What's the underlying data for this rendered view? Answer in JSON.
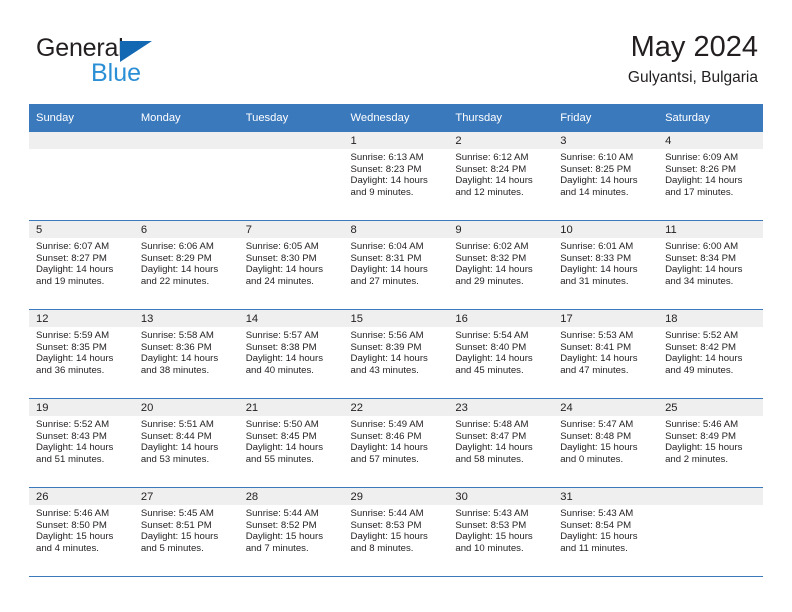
{
  "brand": {
    "name_part1": "General",
    "name_part2": "Blue",
    "triangle_color": "#1268b3",
    "blue_text_color": "#2b8fd6"
  },
  "header": {
    "title": "May 2024",
    "subtitle": "Gulyantsi, Bulgaria"
  },
  "theme": {
    "header_row_bg": "#3b79bd",
    "daynum_band_bg": "#efefef",
    "row_divider": "#3b79bd",
    "text": "#231f20"
  },
  "weekday_headers": [
    "Sunday",
    "Monday",
    "Tuesday",
    "Wednesday",
    "Thursday",
    "Friday",
    "Saturday"
  ],
  "labels": {
    "sunrise_prefix": "Sunrise:",
    "sunset_prefix": "Sunset:",
    "daylight_prefix": "Daylight:"
  },
  "weeks": [
    [
      {
        "empty": true
      },
      {
        "empty": true
      },
      {
        "empty": true
      },
      {
        "day": "1",
        "sunrise": "Sunrise: 6:13 AM",
        "sunset": "Sunset: 8:23 PM",
        "daylight": "Daylight: 14 hours and 9 minutes."
      },
      {
        "day": "2",
        "sunrise": "Sunrise: 6:12 AM",
        "sunset": "Sunset: 8:24 PM",
        "daylight": "Daylight: 14 hours and 12 minutes."
      },
      {
        "day": "3",
        "sunrise": "Sunrise: 6:10 AM",
        "sunset": "Sunset: 8:25 PM",
        "daylight": "Daylight: 14 hours and 14 minutes."
      },
      {
        "day": "4",
        "sunrise": "Sunrise: 6:09 AM",
        "sunset": "Sunset: 8:26 PM",
        "daylight": "Daylight: 14 hours and 17 minutes."
      }
    ],
    [
      {
        "day": "5",
        "sunrise": "Sunrise: 6:07 AM",
        "sunset": "Sunset: 8:27 PM",
        "daylight": "Daylight: 14 hours and 19 minutes."
      },
      {
        "day": "6",
        "sunrise": "Sunrise: 6:06 AM",
        "sunset": "Sunset: 8:29 PM",
        "daylight": "Daylight: 14 hours and 22 minutes."
      },
      {
        "day": "7",
        "sunrise": "Sunrise: 6:05 AM",
        "sunset": "Sunset: 8:30 PM",
        "daylight": "Daylight: 14 hours and 24 minutes."
      },
      {
        "day": "8",
        "sunrise": "Sunrise: 6:04 AM",
        "sunset": "Sunset: 8:31 PM",
        "daylight": "Daylight: 14 hours and 27 minutes."
      },
      {
        "day": "9",
        "sunrise": "Sunrise: 6:02 AM",
        "sunset": "Sunset: 8:32 PM",
        "daylight": "Daylight: 14 hours and 29 minutes."
      },
      {
        "day": "10",
        "sunrise": "Sunrise: 6:01 AM",
        "sunset": "Sunset: 8:33 PM",
        "daylight": "Daylight: 14 hours and 31 minutes."
      },
      {
        "day": "11",
        "sunrise": "Sunrise: 6:00 AM",
        "sunset": "Sunset: 8:34 PM",
        "daylight": "Daylight: 14 hours and 34 minutes."
      }
    ],
    [
      {
        "day": "12",
        "sunrise": "Sunrise: 5:59 AM",
        "sunset": "Sunset: 8:35 PM",
        "daylight": "Daylight: 14 hours and 36 minutes."
      },
      {
        "day": "13",
        "sunrise": "Sunrise: 5:58 AM",
        "sunset": "Sunset: 8:36 PM",
        "daylight": "Daylight: 14 hours and 38 minutes."
      },
      {
        "day": "14",
        "sunrise": "Sunrise: 5:57 AM",
        "sunset": "Sunset: 8:38 PM",
        "daylight": "Daylight: 14 hours and 40 minutes."
      },
      {
        "day": "15",
        "sunrise": "Sunrise: 5:56 AM",
        "sunset": "Sunset: 8:39 PM",
        "daylight": "Daylight: 14 hours and 43 minutes."
      },
      {
        "day": "16",
        "sunrise": "Sunrise: 5:54 AM",
        "sunset": "Sunset: 8:40 PM",
        "daylight": "Daylight: 14 hours and 45 minutes."
      },
      {
        "day": "17",
        "sunrise": "Sunrise: 5:53 AM",
        "sunset": "Sunset: 8:41 PM",
        "daylight": "Daylight: 14 hours and 47 minutes."
      },
      {
        "day": "18",
        "sunrise": "Sunrise: 5:52 AM",
        "sunset": "Sunset: 8:42 PM",
        "daylight": "Daylight: 14 hours and 49 minutes."
      }
    ],
    [
      {
        "day": "19",
        "sunrise": "Sunrise: 5:52 AM",
        "sunset": "Sunset: 8:43 PM",
        "daylight": "Daylight: 14 hours and 51 minutes."
      },
      {
        "day": "20",
        "sunrise": "Sunrise: 5:51 AM",
        "sunset": "Sunset: 8:44 PM",
        "daylight": "Daylight: 14 hours and 53 minutes."
      },
      {
        "day": "21",
        "sunrise": "Sunrise: 5:50 AM",
        "sunset": "Sunset: 8:45 PM",
        "daylight": "Daylight: 14 hours and 55 minutes."
      },
      {
        "day": "22",
        "sunrise": "Sunrise: 5:49 AM",
        "sunset": "Sunset: 8:46 PM",
        "daylight": "Daylight: 14 hours and 57 minutes."
      },
      {
        "day": "23",
        "sunrise": "Sunrise: 5:48 AM",
        "sunset": "Sunset: 8:47 PM",
        "daylight": "Daylight: 14 hours and 58 minutes."
      },
      {
        "day": "24",
        "sunrise": "Sunrise: 5:47 AM",
        "sunset": "Sunset: 8:48 PM",
        "daylight": "Daylight: 15 hours and 0 minutes."
      },
      {
        "day": "25",
        "sunrise": "Sunrise: 5:46 AM",
        "sunset": "Sunset: 8:49 PM",
        "daylight": "Daylight: 15 hours and 2 minutes."
      }
    ],
    [
      {
        "day": "26",
        "sunrise": "Sunrise: 5:46 AM",
        "sunset": "Sunset: 8:50 PM",
        "daylight": "Daylight: 15 hours and 4 minutes."
      },
      {
        "day": "27",
        "sunrise": "Sunrise: 5:45 AM",
        "sunset": "Sunset: 8:51 PM",
        "daylight": "Daylight: 15 hours and 5 minutes."
      },
      {
        "day": "28",
        "sunrise": "Sunrise: 5:44 AM",
        "sunset": "Sunset: 8:52 PM",
        "daylight": "Daylight: 15 hours and 7 minutes."
      },
      {
        "day": "29",
        "sunrise": "Sunrise: 5:44 AM",
        "sunset": "Sunset: 8:53 PM",
        "daylight": "Daylight: 15 hours and 8 minutes."
      },
      {
        "day": "30",
        "sunrise": "Sunrise: 5:43 AM",
        "sunset": "Sunset: 8:53 PM",
        "daylight": "Daylight: 15 hours and 10 minutes."
      },
      {
        "day": "31",
        "sunrise": "Sunrise: 5:43 AM",
        "sunset": "Sunset: 8:54 PM",
        "daylight": "Daylight: 15 hours and 11 minutes."
      },
      {
        "empty": true
      }
    ]
  ]
}
